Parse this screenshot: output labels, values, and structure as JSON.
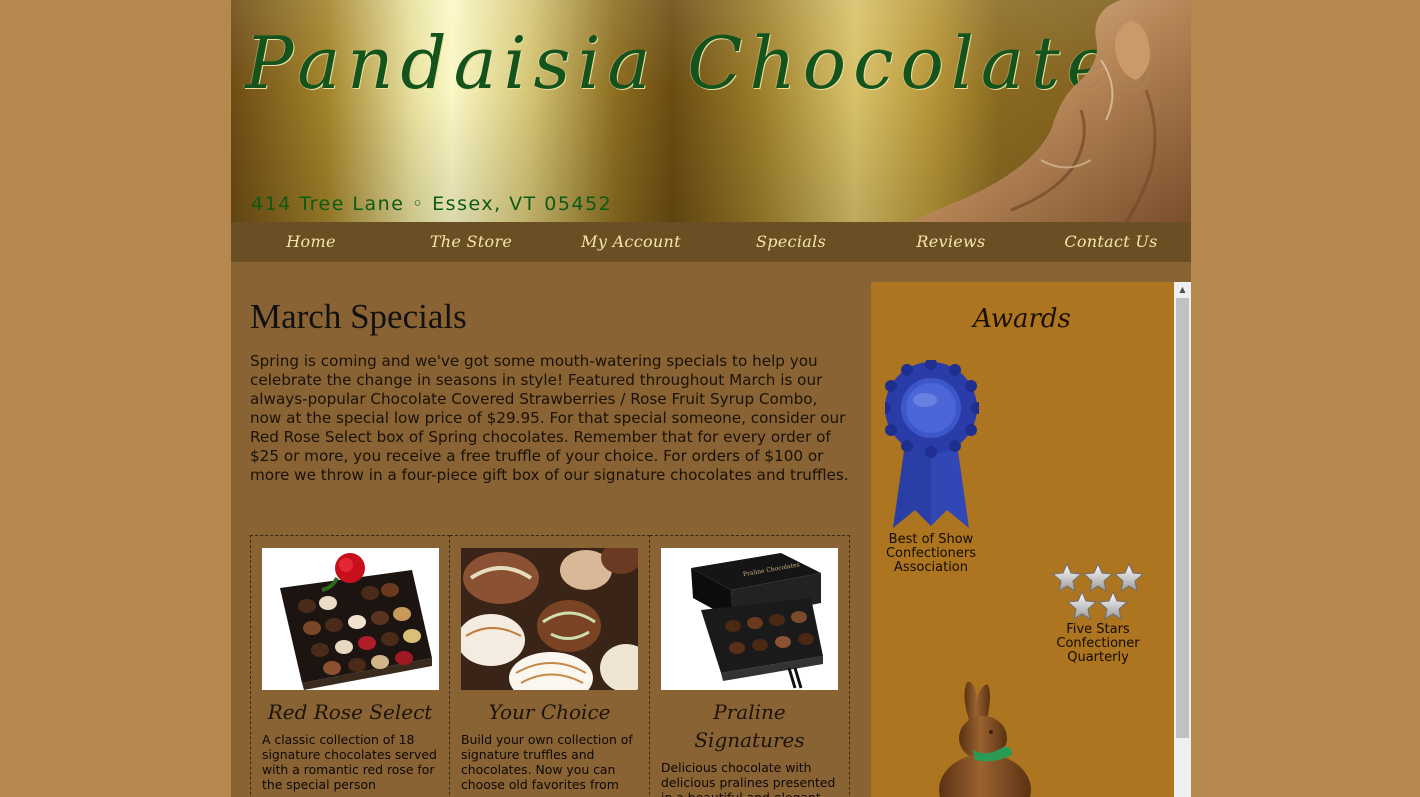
{
  "header": {
    "logo_text": "Pandaisia Chocolates",
    "address": "414 Tree Lane ◦ Essex, VT 05452"
  },
  "nav": {
    "items": [
      {
        "label": "Home"
      },
      {
        "label": "The Store"
      },
      {
        "label": "My Account"
      },
      {
        "label": "Specials"
      },
      {
        "label": "Reviews"
      },
      {
        "label": "Contact Us"
      }
    ]
  },
  "main": {
    "title": "March Specials",
    "intro": "Spring is coming and we've got some mouth-watering specials to help you celebrate the change in seasons in style! Featured throughout March is our always-popular Chocolate Covered Strawberries / Rose Fruit Syrup Combo, now at the special low price of $29.95. For that special someone, consider our Red Rose Select box of Spring chocolates. Remember that for every order of $25 or more, you receive a free truffle of your choice. For orders of $100 or more we throw in a four-piece gift box of our signature chocolates and truffles.",
    "products": [
      {
        "name": "Red Rose Select",
        "desc": "A classic collection of 18 signature chocolates served with a romantic red rose for the special person"
      },
      {
        "name": "Your Choice",
        "desc": "Build your own collection of signature truffles and chocolates. Now you can choose old favorites from"
      },
      {
        "name": "Praline Signatures",
        "desc": "Delicious chocolate with delicious pralines presented in a beautiful and elegant box. Enjoy this"
      }
    ]
  },
  "sidebar": {
    "title": "Awards",
    "award1": {
      "line1": "Best of Show",
      "line2": "Confectioners",
      "line3": "Association"
    },
    "award2": {
      "line1": "Five Stars",
      "line2": "Confectioner",
      "line3": "Quarterly"
    }
  },
  "colors": {
    "page_bg": "#b5884e",
    "content_bg": "#8a6335",
    "nav_bg": "#6a4f24",
    "sidebar_bg": "#ad7520",
    "logo_green": "#14531c"
  }
}
